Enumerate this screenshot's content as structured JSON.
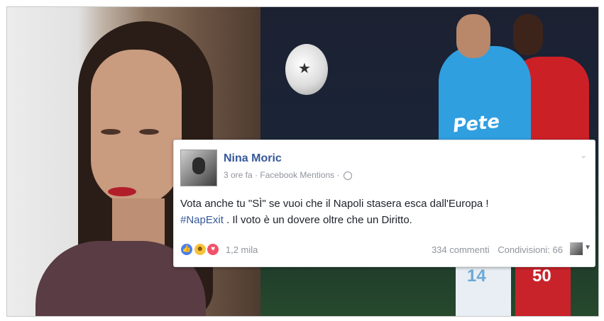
{
  "post": {
    "author": "Nina Moric",
    "time": "3 ore fa",
    "source": "Facebook Mentions",
    "separator": "·",
    "text_before_tag": "Vota anche tu \"SÌ\" se vuoi che il Napoli stasera esca dall'Europa !",
    "hashtag": "#NapExit",
    "text_after_tag": " . Il voto è un dovere oltre che un Diritto.",
    "reactions_count": "1,2 mila",
    "comments": "334 commenti",
    "shares": "Condivisioni: 66"
  },
  "background": {
    "sponsor_text": "Pete",
    "jersey_number_white": "14",
    "jersey_number_red": "50"
  },
  "icons": {
    "globe": "globe-icon",
    "chevron": "chevron-down-icon",
    "like": "like-reaction-icon",
    "haha": "haha-reaction-icon",
    "love": "love-reaction-icon"
  },
  "colors": {
    "fb_link": "#365899",
    "meta_gray": "#90949c",
    "napoli_blue": "#2f9fe0",
    "benfica_red": "#cc2027"
  }
}
